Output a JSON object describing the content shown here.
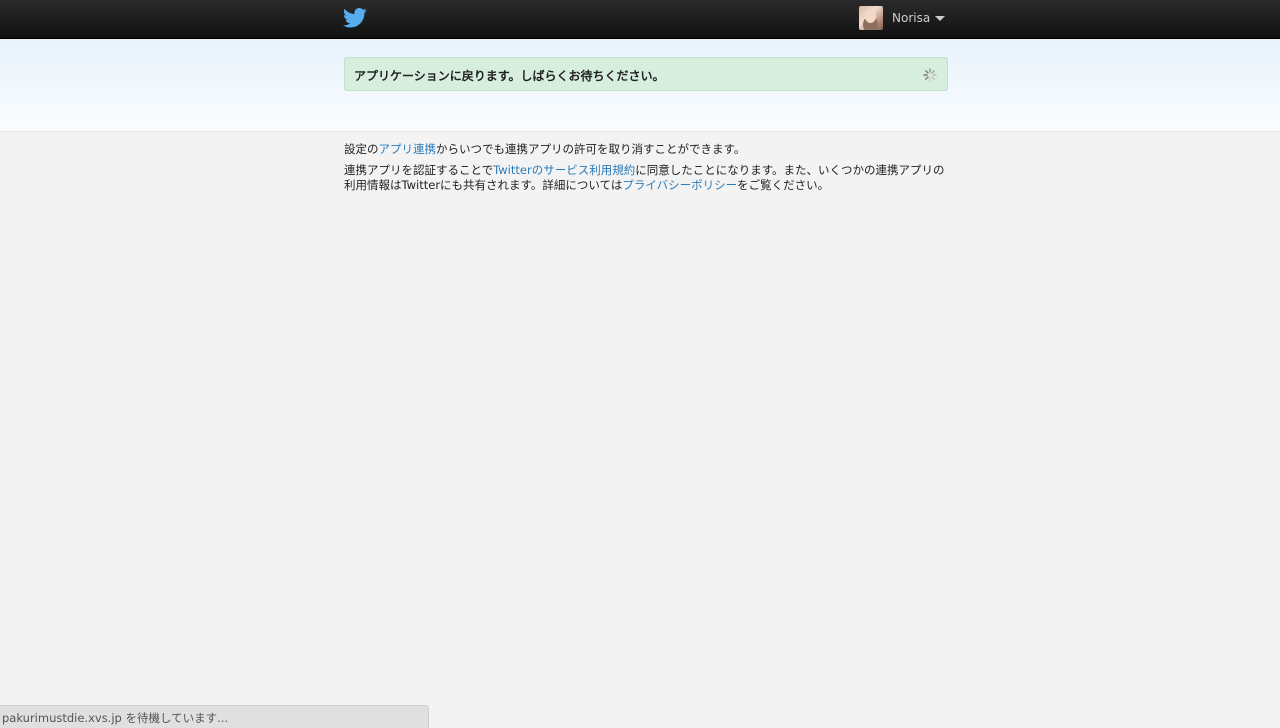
{
  "topbar": {
    "logo_icon": "twitter-bird-icon",
    "logo_color": "#55acee",
    "user": {
      "name": "Norisa",
      "avatar_icon": "user-avatar",
      "menu_icon": "caret-down-icon"
    }
  },
  "notice": {
    "message": "アプリケーションに戻ります。しばらくお待ちください。",
    "spinner_icon": "loading-spinner-icon",
    "background": "#d7eedf"
  },
  "info": {
    "line1_before": "設定の",
    "line1_link": "アプリ連携",
    "line1_after": "からいつでも連携アプリの許可を取り消すことができます。",
    "line2_before": "連携アプリを認証することで",
    "line2_link": "Twitterのサービス利用規約",
    "line2_middle": "に同意したことになります。また、いくつかの連携アプリの利用情報はTwitterにも共有されます。詳細については",
    "line2_link2": "プライバシーポリシー",
    "line2_after": "をご覧ください。",
    "link_color": "#2b7bb9"
  },
  "statusbar": {
    "text": "pakurimustdie.xvs.jp を待機しています..."
  }
}
